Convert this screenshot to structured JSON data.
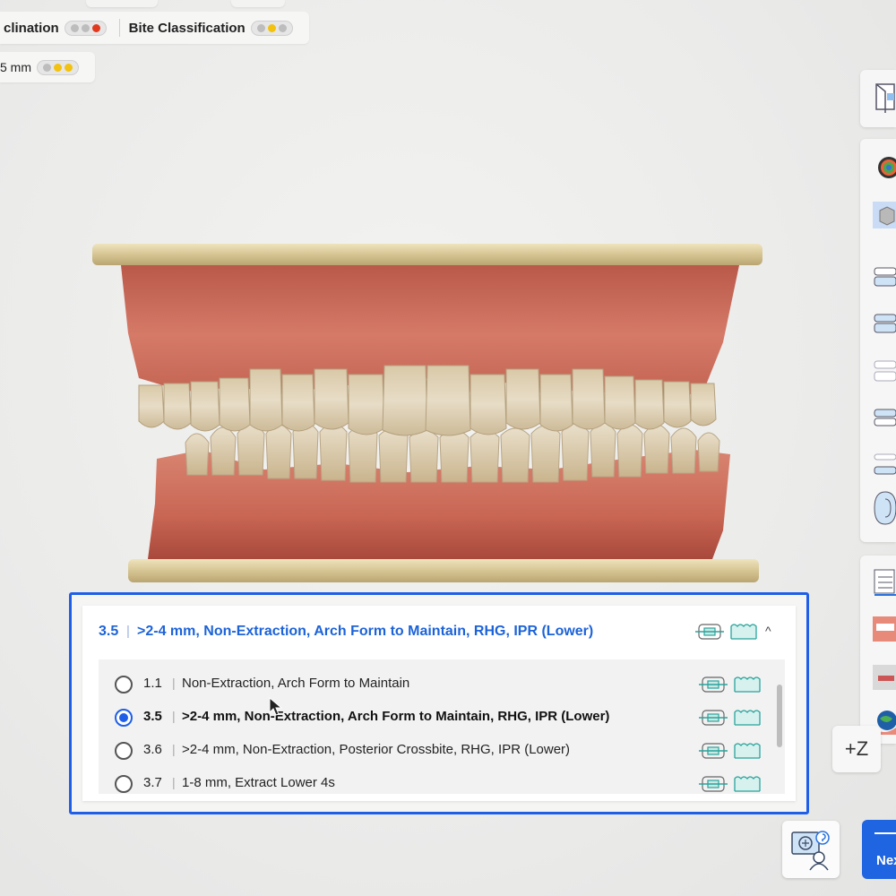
{
  "status_chips": {
    "row1": [
      {
        "label": "clination",
        "dots": [
          "gray",
          "gray",
          "red"
        ]
      },
      {
        "label": "Bite Classification",
        "dots": [
          "gray",
          "yellow",
          "gray"
        ]
      }
    ],
    "row2": [
      {
        "label": "5 mm",
        "dots": [
          "gray",
          "yellow",
          "yellow"
        ]
      }
    ]
  },
  "colors": {
    "accent": "#1f5fe8",
    "status_red": "#e2391e",
    "status_yellow": "#f2c20f",
    "gingiva": "#c96a5a",
    "base": "#d8c79a"
  },
  "right_toolbar": {
    "icons": [
      "model-view-icon",
      "color-map-icon",
      "cube-view-icon",
      "upper-arch-icon",
      "bite-view-icon",
      "lower-arch-icon",
      "separate-view-icon",
      "stacked-view-icon",
      "occlusal-icon",
      "report-icon",
      "smile-photo-icon",
      "face-photo-icon",
      "globe-icon"
    ]
  },
  "zoom_axis": {
    "label": "+Z"
  },
  "help_button": {
    "icon": "consult-expert-icon"
  },
  "next_button": {
    "label": "Nex"
  },
  "treatment_panel": {
    "selected_code": "3.5",
    "selected_title": ">2-4 mm, Non-Extraction, Arch Form to Maintain, RHG, IPR (Lower)",
    "collapse_icon": "chevron-up-icon",
    "options": [
      {
        "code": "1.1",
        "description": "Non-Extraction, Arch Form to Maintain",
        "selected": false
      },
      {
        "code": "3.5",
        "description": ">2-4 mm, Non-Extraction, Arch Form to Maintain, RHG, IPR (Lower)",
        "selected": true
      },
      {
        "code": "3.6",
        "description": ">2-4 mm, Non-Extraction, Posterior Crossbite, RHG, IPR (Lower)",
        "selected": false
      },
      {
        "code": "3.7",
        "description": "1-8 mm, Extract Lower 4s",
        "selected": false
      }
    ]
  }
}
